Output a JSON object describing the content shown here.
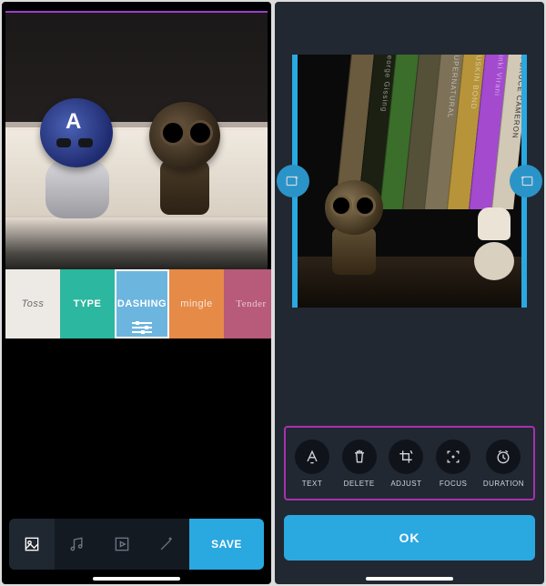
{
  "left": {
    "styles": [
      {
        "label": "Toss",
        "bg": "#edeae6",
        "fg": "#6b6b6b",
        "font_style": "italic"
      },
      {
        "label": "TYPE",
        "bg": "#2cb7a0",
        "fg": "#ffffff",
        "font_style": "bold"
      },
      {
        "label": "DASHING",
        "bg": "#6cb5de",
        "fg": "#ffffff",
        "font_style": "bold",
        "selected": true
      },
      {
        "label": "mingle",
        "bg": "#e58a47",
        "fg": "#f7e8d8",
        "font_style": "normal"
      },
      {
        "label": "Tender",
        "bg": "#b85a7a",
        "fg": "#e9c7d4",
        "font_style": "serif"
      }
    ],
    "bottom_tabs": [
      {
        "name": "media-tab",
        "icon": "media-icon",
        "active": true
      },
      {
        "name": "music-tab",
        "icon": "music-icon",
        "active": false
      },
      {
        "name": "layout-tab",
        "icon": "play-square-icon",
        "active": false
      },
      {
        "name": "magic-tab",
        "icon": "wand-icon",
        "active": false
      }
    ],
    "save_label": "SAVE"
  },
  "right": {
    "trim_left_icon": "add-clip-left-icon",
    "trim_right_icon": "add-clip-right-icon",
    "actions": [
      {
        "label": "TEXT",
        "icon": "text-icon"
      },
      {
        "label": "DELETE",
        "icon": "trash-icon"
      },
      {
        "label": "ADJUST",
        "icon": "crop-rotate-icon"
      },
      {
        "label": "FOCUS",
        "icon": "focus-icon"
      },
      {
        "label": "DURATION",
        "icon": "clock-icon"
      }
    ],
    "ok_label": "OK",
    "book_spines": [
      {
        "text": "",
        "bg": "#6a5a3e"
      },
      {
        "text": "Ceorge Gissing",
        "bg": "#1c2012"
      },
      {
        "text": "",
        "bg": "#3a6e2a"
      },
      {
        "text": "",
        "bg": "#555038"
      },
      {
        "text": "SUPERNATURAL",
        "bg": "#7d7158"
      },
      {
        "text": "RUSKIN BOND",
        "bg": "#b7943a"
      },
      {
        "text": "Pinki Virani",
        "bg": "#a44acf"
      },
      {
        "text": "W. BRUCE CAMERON",
        "bg": "#d1c8b5"
      }
    ]
  }
}
